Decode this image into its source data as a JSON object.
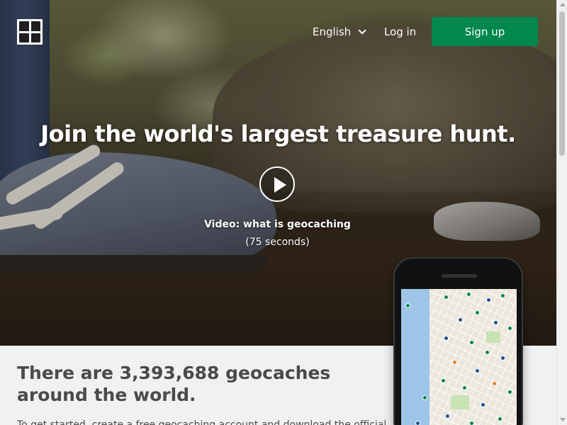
{
  "header": {
    "logo_icon": "geocaching-logo-icon",
    "language_label": "English",
    "login_label": "Log in",
    "signup_label": "Sign up"
  },
  "hero": {
    "title": "Join the world's largest treasure hunt.",
    "play_icon": "play-icon",
    "video_label": "Video: what is geocaching",
    "video_duration": "(75 seconds)"
  },
  "intro": {
    "heading": "There are 3,393,688 geocaches around the world.",
    "body": "To get started, create a free geocaching account and download the official"
  },
  "colors": {
    "brand_green": "#02874d",
    "heading_text": "#4a4a4a",
    "section_bg": "#f1f1f1"
  }
}
